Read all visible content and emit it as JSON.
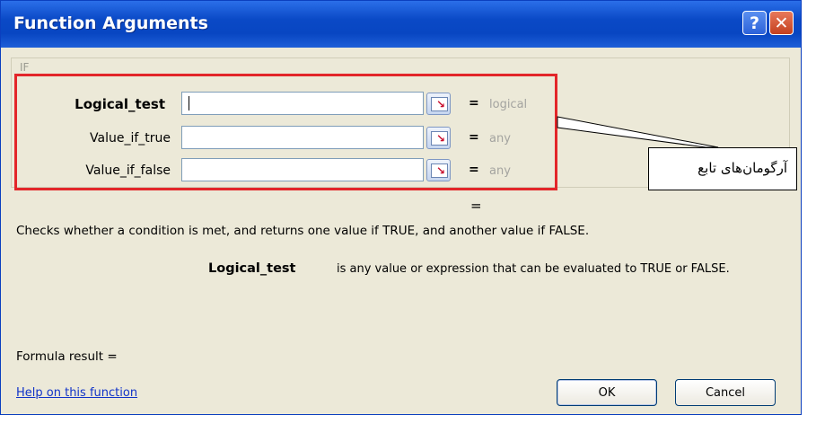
{
  "window": {
    "title": "Function Arguments",
    "help_glyph": "?",
    "close_glyph": "✕"
  },
  "function": {
    "name": "IF",
    "arguments": [
      {
        "label": "Logical_test",
        "value": "",
        "result": "logical"
      },
      {
        "label": "Value_if_true",
        "value": "",
        "result": "any"
      },
      {
        "label": "Value_if_false",
        "value": "",
        "result": "any"
      }
    ],
    "equals_sign": "=",
    "description": "Checks whether a condition is met, and returns one value if TRUE, and another value if FALSE.",
    "arg_help_name": "Logical_test",
    "arg_help_text": "is any value or expression that can be evaluated to TRUE or FALSE."
  },
  "annotation": {
    "callout_text": "آرگومان‌های تابع",
    "highlight_color": "#e3262a"
  },
  "footer": {
    "formula_result": "Formula result =",
    "help_link": "Help on this function",
    "ok_label": "OK",
    "cancel_label": "Cancel"
  },
  "colors": {
    "titlebar": "#0846c2",
    "dialog_bg": "#ece9d8",
    "link": "#1033c8"
  }
}
